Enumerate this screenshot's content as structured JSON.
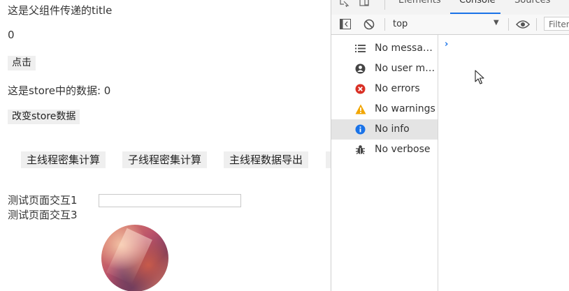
{
  "app": {
    "title_line": "这是父组件传递的title",
    "count": "0",
    "click_button": "点击",
    "store_line": "这是store中的数据: 0",
    "change_store_button": "改变store数据",
    "actions": [
      "主线程密集计算",
      "子线程密集计算",
      "主线程数据导出"
    ],
    "interaction_1": "测试页面交互1",
    "interaction_3": "测试页面交互3",
    "input_value": ""
  },
  "devtools": {
    "tabs": [
      "Elements",
      "Console",
      "Sources"
    ],
    "active_tab": "Console",
    "context": "top",
    "filter_placeholder": "Filter",
    "sidebar": [
      {
        "label": "No messages",
        "icon": "list-icon"
      },
      {
        "label": "No user me...",
        "icon": "user-icon"
      },
      {
        "label": "No errors",
        "icon": "error-icon"
      },
      {
        "label": "No warnings",
        "icon": "warning-icon"
      },
      {
        "label": "No info",
        "icon": "info-icon",
        "selected": true
      },
      {
        "label": "No verbose",
        "icon": "bug-icon"
      }
    ],
    "prompt": "›",
    "colors": {
      "error": "#d93025",
      "warning": "#f2a600",
      "info": "#1a73e8",
      "accent": "#1a73e8"
    }
  }
}
